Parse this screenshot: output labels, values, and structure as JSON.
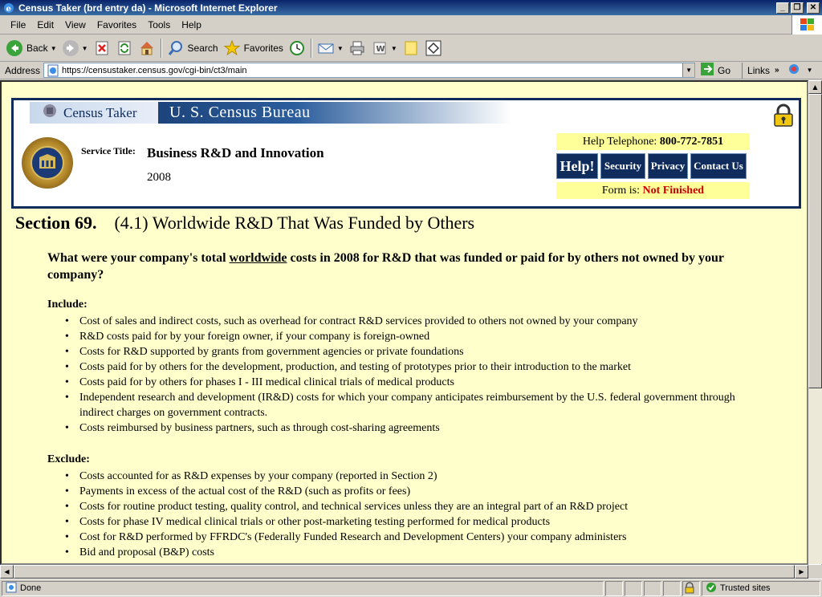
{
  "window": {
    "title": "Census Taker (brd entry da) - Microsoft Internet Explorer",
    "buttons": {
      "minimize": "_",
      "maximize": "❐",
      "close": "✕"
    }
  },
  "menu": [
    {
      "label": "File",
      "accel": "F"
    },
    {
      "label": "Edit",
      "accel": "E"
    },
    {
      "label": "View",
      "accel": "V"
    },
    {
      "label": "Favorites",
      "accel": "a"
    },
    {
      "label": "Tools",
      "accel": "T"
    },
    {
      "label": "Help",
      "accel": "H"
    }
  ],
  "toolbar": {
    "back": "Back",
    "search": "Search",
    "favorites": "Favorites"
  },
  "address": {
    "label": "Address",
    "url": "https://censustaker.census.gov/cgi-bin/ct3/main",
    "go": "Go",
    "links": "Links"
  },
  "header": {
    "brand": "Census Taker",
    "bureau": "U. S. Census Bureau",
    "service_label": "Service Title:",
    "service_title": "Business R&D and Innovation",
    "year": "2008",
    "help_tel_label": "Help Telephone:",
    "help_tel": "800-772-7851",
    "buttons": {
      "help": "Help!",
      "security": "Security",
      "privacy": "Privacy",
      "contact": "Contact Us"
    },
    "form_label": "Form is:",
    "form_status": "Not Finished"
  },
  "section": {
    "number": "Section 69.",
    "title": "(4.1) Worldwide R&D That Was Funded by Others",
    "question_pre": "What were your company's total ",
    "question_emph": "worldwide",
    "question_post": " costs in 2008 for R&D that was funded or paid for by others not owned by your company?",
    "include_label": "Include",
    "include": [
      "Cost of sales and indirect costs, such as overhead for contract R&D services provided to others not owned by your company",
      "R&D costs paid for by your foreign owner, if your company is foreign-owned",
      "Costs for R&D supported by grants from government agencies or private foundations",
      "Costs paid for by others for the development, production, and testing of prototypes prior to their introduction to the market",
      "Costs paid for by others for phases I - III medical clinical trials of medical products",
      "Independent research and development (IR&D) costs for which your company anticipates reimbursement by the U.S. federal government through indirect charges on government contracts.",
      "Costs reimbursed by business partners, such as through cost-sharing agreements"
    ],
    "exclude_label": "Exclude",
    "exclude": [
      "Costs accounted for as R&D expenses by your company (reported in Section 2)",
      "Payments in excess of the actual cost of the R&D (such as profits or fees)",
      "Costs for routine product testing, quality control, and technical services unless they are an integral part of an R&D project",
      "Costs for phase IV medical clinical trials or other post-marketing testing performed for medical products",
      "Cost for R&D performed by FFRDC's (Federally Funded Research and Development Centers) your company administers",
      "Bid and proposal (B&P) costs"
    ]
  },
  "status": {
    "text": "Done",
    "zone": "Trusted sites"
  }
}
